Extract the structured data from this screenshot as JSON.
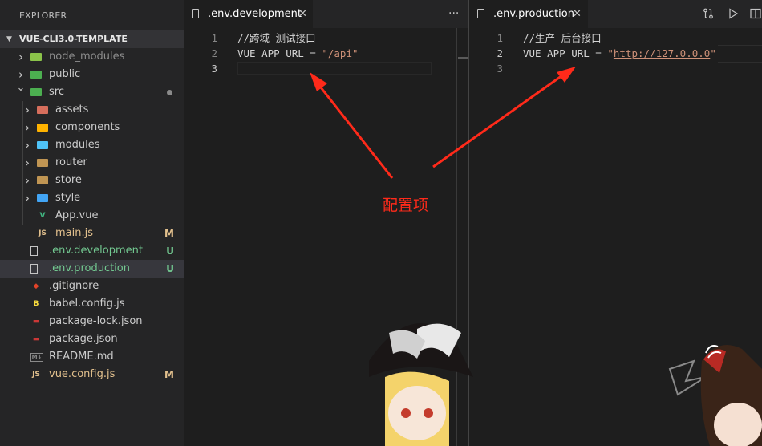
{
  "explorer": {
    "title": "EXPLORER",
    "project": "VUE-CLI3.0-TEMPLATE",
    "items": [
      {
        "name": "node_modules",
        "type": "folder",
        "depth": 0,
        "expanded": false,
        "icon": "node-modules-folder-icon",
        "color": "#8c8c8c"
      },
      {
        "name": "public",
        "type": "folder",
        "depth": 0,
        "expanded": false,
        "icon": "public-folder-icon",
        "color": "#cccccc"
      },
      {
        "name": "src",
        "type": "folder",
        "depth": 0,
        "expanded": true,
        "icon": "src-folder-icon",
        "color": "#cccccc",
        "modified_dot": true
      },
      {
        "name": "assets",
        "type": "folder",
        "depth": 1,
        "expanded": false,
        "icon": "assets-folder-icon",
        "color": "#cccccc"
      },
      {
        "name": "components",
        "type": "folder",
        "depth": 1,
        "expanded": false,
        "icon": "components-folder-icon",
        "color": "#cccccc"
      },
      {
        "name": "modules",
        "type": "folder",
        "depth": 1,
        "expanded": false,
        "icon": "modules-folder-icon",
        "color": "#cccccc"
      },
      {
        "name": "router",
        "type": "folder",
        "depth": 1,
        "expanded": false,
        "icon": "router-folder-icon",
        "color": "#cccccc"
      },
      {
        "name": "store",
        "type": "folder",
        "depth": 1,
        "expanded": false,
        "icon": "store-folder-icon",
        "color": "#cccccc"
      },
      {
        "name": "style",
        "type": "folder",
        "depth": 1,
        "expanded": false,
        "icon": "style-folder-icon",
        "color": "#cccccc"
      },
      {
        "name": "App.vue",
        "type": "file",
        "depth": 1,
        "icon": "vue-icon",
        "color": "#cccccc"
      },
      {
        "name": "main.js",
        "type": "file",
        "depth": 1,
        "icon": "js-icon",
        "color": "#e2c08d",
        "badge": "M"
      },
      {
        "name": ".env.development",
        "type": "file",
        "depth": 0,
        "icon": "file-icon",
        "color": "#73c991",
        "badge": "U"
      },
      {
        "name": ".env.production",
        "type": "file",
        "depth": 0,
        "icon": "file-icon",
        "color": "#73c991",
        "badge": "U",
        "selected": true
      },
      {
        "name": ".gitignore",
        "type": "file",
        "depth": 0,
        "icon": "git-icon",
        "color": "#cccccc"
      },
      {
        "name": "babel.config.js",
        "type": "file",
        "depth": 0,
        "icon": "babel-icon",
        "color": "#cccccc"
      },
      {
        "name": "package-lock.json",
        "type": "file",
        "depth": 0,
        "icon": "npm-icon",
        "color": "#cccccc"
      },
      {
        "name": "package.json",
        "type": "file",
        "depth": 0,
        "icon": "npm-icon",
        "color": "#cccccc"
      },
      {
        "name": "README.md",
        "type": "file",
        "depth": 0,
        "icon": "markdown-icon",
        "color": "#cccccc"
      },
      {
        "name": "vue.config.js",
        "type": "file",
        "depth": 0,
        "icon": "js-icon",
        "color": "#e2c08d",
        "badge": "M"
      }
    ]
  },
  "left_editor": {
    "tab_label": ".env.development",
    "more_label": "···",
    "lines": [
      {
        "num": "1",
        "text": "//跨域 测试接口"
      },
      {
        "num": "2",
        "key": "VUE_APP_URL = ",
        "value": "\"/api\""
      },
      {
        "num": "3",
        "text": ""
      }
    ]
  },
  "right_editor": {
    "tab_label": ".env.production",
    "lines": [
      {
        "num": "1",
        "text": "//生产 后台接口"
      },
      {
        "num": "2",
        "key": "VUE_APP_URL = ",
        "quote_open": "\"",
        "url": "http://127.0.0.0",
        "quote_close": "\""
      },
      {
        "num": "3",
        "text": ""
      }
    ]
  },
  "annotation": {
    "label": "配置项",
    "color": "#ff2a1a"
  },
  "colors": {
    "badge_modified": "#e2c08d",
    "badge_untracked": "#73c991",
    "accent": "#ff2a1a"
  }
}
